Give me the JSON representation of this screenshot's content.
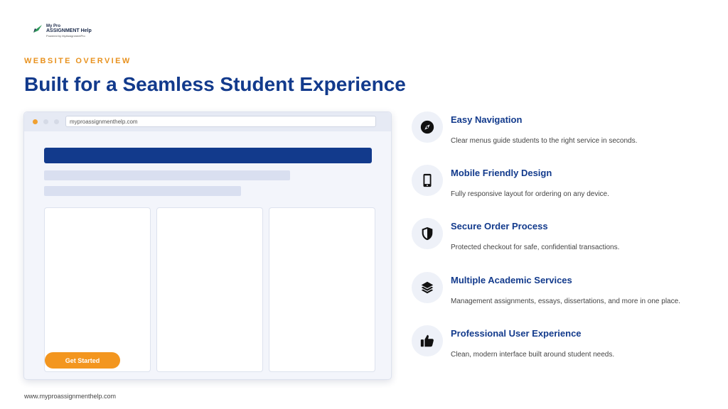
{
  "logo": {
    "line1": "My Pro",
    "line2": "ASSIGNMENT Help",
    "line3": "Powered by MyAssignmentPro"
  },
  "header": {
    "eyebrow": "WEBSITE OVERVIEW",
    "title": "Built for a Seamless Student Experience"
  },
  "browser": {
    "url": "myproassignmenthelp.com",
    "cta_label": "Get Started"
  },
  "features": [
    {
      "icon": "compass-icon",
      "title": "Easy Navigation",
      "description": "Clear menus guide students to the right service in seconds."
    },
    {
      "icon": "mobile-phone-icon",
      "title": "Mobile Friendly Design",
      "description": "Fully responsive layout for ordering on any device."
    },
    {
      "icon": "shield-icon",
      "title": "Secure Order Process",
      "description": "Protected checkout for safe, confidential transactions."
    },
    {
      "icon": "layers-icon",
      "title": "Multiple Academic Services",
      "description": "Management assignments, essays, dissertations, and more in one place."
    },
    {
      "icon": "thumbs-up-icon",
      "title": "Professional User Experience",
      "description": "Clean, modern interface built around student needs."
    }
  ],
  "footer": {
    "url": "www.myproassignmenthelp.com"
  },
  "colors": {
    "primary": "#123a8c",
    "accent": "#f3961f",
    "eyebrow": "#e8921f",
    "icon_bg": "#eef1f8"
  }
}
